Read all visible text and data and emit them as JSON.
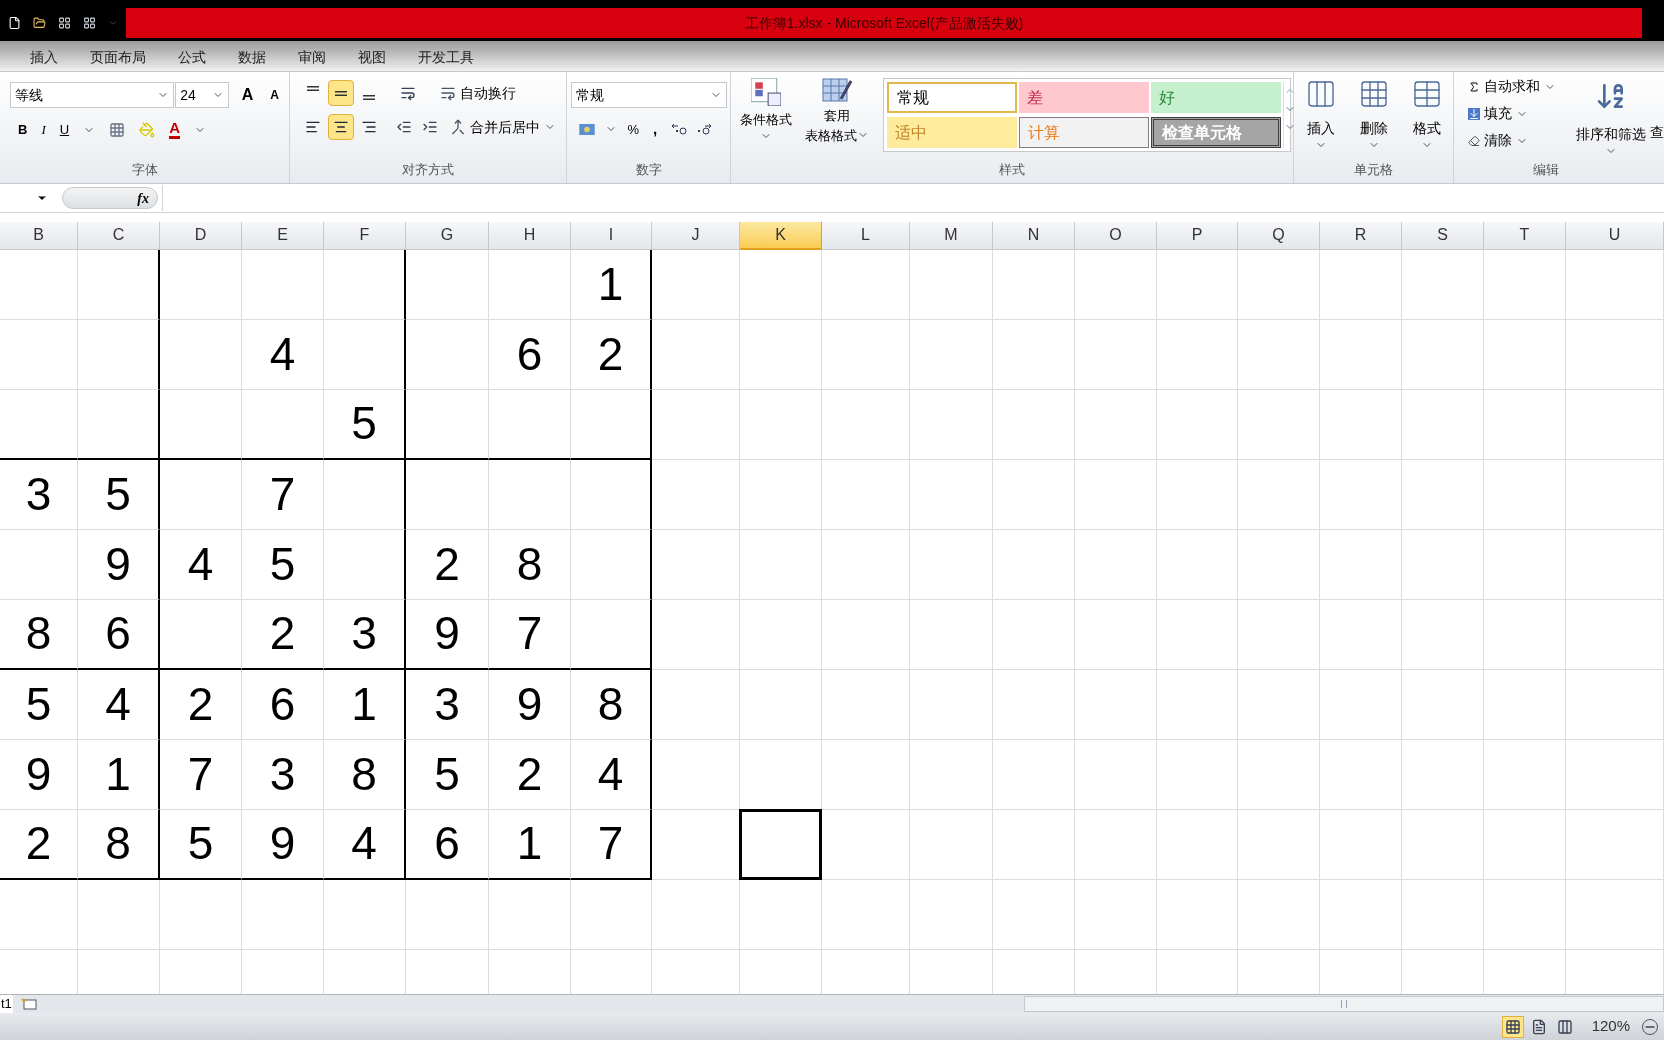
{
  "title_bar": {
    "title": "工作簿1.xlsx - Microsoft Excel(产品激活失败)"
  },
  "ribbon_tabs": [
    "插入",
    "页面布局",
    "公式",
    "数据",
    "审阅",
    "视图",
    "开发工具"
  ],
  "font_group": {
    "label": "字体",
    "font_name": "等线",
    "font_size": "24",
    "grow": "A",
    "shrink": "A",
    "styles": [
      "B",
      "I",
      "U"
    ],
    "font_color": "A"
  },
  "alignment_group": {
    "label": "对齐方式",
    "vertical": [
      {
        "selected": false
      },
      {
        "selected": true
      },
      {
        "selected": false
      }
    ],
    "horizontal": [
      {
        "selected": false
      },
      {
        "selected": true
      },
      {
        "selected": false
      }
    ],
    "wrap_text": "自动换行",
    "merge_center": "合并后居中"
  },
  "number_group": {
    "label": "数字",
    "format": "常规",
    "percent": "%",
    "comma": ","
  },
  "styles_group": {
    "label": "样式",
    "conditional_format": "条件格式",
    "table_format": [
      "套用",
      "表格格式"
    ],
    "styles": [
      {
        "label": "常规",
        "kind": "normal"
      },
      {
        "label": "差",
        "kind": "bad"
      },
      {
        "label": "好",
        "kind": "good"
      },
      {
        "label": "适中",
        "kind": "neutral"
      },
      {
        "label": "计算",
        "kind": "calculation"
      },
      {
        "label": "检查单元格",
        "kind": "check"
      }
    ]
  },
  "cells_group": {
    "label": "单元格",
    "buttons": [
      "插入",
      "删除",
      "格式"
    ]
  },
  "editing_group": {
    "label": "编辑",
    "autosum": "自动求和",
    "fill": "填充",
    "clear": "清除",
    "sort_filter": "排序和筛选",
    "find": "查"
  },
  "formula_bar": {
    "fx": "fx"
  },
  "columns": [
    {
      "label": "B",
      "selected": false
    },
    {
      "label": "C",
      "selected": false
    },
    {
      "label": "D",
      "selected": false
    },
    {
      "label": "E",
      "selected": false
    },
    {
      "label": "F",
      "selected": false
    },
    {
      "label": "G",
      "selected": false
    },
    {
      "label": "H",
      "selected": false
    },
    {
      "label": "I",
      "selected": false
    },
    {
      "label": "J",
      "selected": false
    },
    {
      "label": "K",
      "selected": true
    },
    {
      "label": "L",
      "selected": false
    },
    {
      "label": "M",
      "selected": false
    },
    {
      "label": "N",
      "selected": false
    },
    {
      "label": "O",
      "selected": false
    },
    {
      "label": "P",
      "selected": false
    },
    {
      "label": "Q",
      "selected": false
    },
    {
      "label": "R",
      "selected": false
    },
    {
      "label": "S",
      "selected": false
    },
    {
      "label": "T",
      "selected": false
    },
    {
      "label": "U",
      "selected": false
    }
  ],
  "rows": [
    {
      "cells": [
        null,
        null,
        null,
        null,
        null,
        null,
        null,
        "1"
      ]
    },
    {
      "cells": [
        null,
        null,
        null,
        "4",
        null,
        null,
        "6",
        "2"
      ]
    },
    {
      "cells": [
        null,
        null,
        null,
        null,
        "5",
        null,
        null,
        null
      ]
    },
    {
      "cells": [
        "3",
        "5",
        null,
        "7",
        null,
        null,
        null,
        null
      ]
    },
    {
      "cells": [
        null,
        "9",
        "4",
        "5",
        null,
        "2",
        "8",
        null
      ]
    },
    {
      "cells": [
        "8",
        "6",
        null,
        "2",
        "3",
        "9",
        "7",
        null
      ]
    },
    {
      "cells": [
        "5",
        "4",
        "2",
        "6",
        "1",
        "3",
        "9",
        "8"
      ]
    },
    {
      "cells": [
        "9",
        "1",
        "7",
        "3",
        "8",
        "5",
        "2",
        "4"
      ]
    },
    {
      "active_cell": true,
      "cells": [
        "2",
        "8",
        "5",
        "9",
        "4",
        "6",
        "1",
        "7"
      ]
    }
  ],
  "sheet_tabs": [
    "t1"
  ],
  "status_bar": {
    "views": [
      {
        "selected": true
      },
      {
        "selected": false
      },
      {
        "selected": false
      }
    ],
    "zoom": "120%"
  }
}
